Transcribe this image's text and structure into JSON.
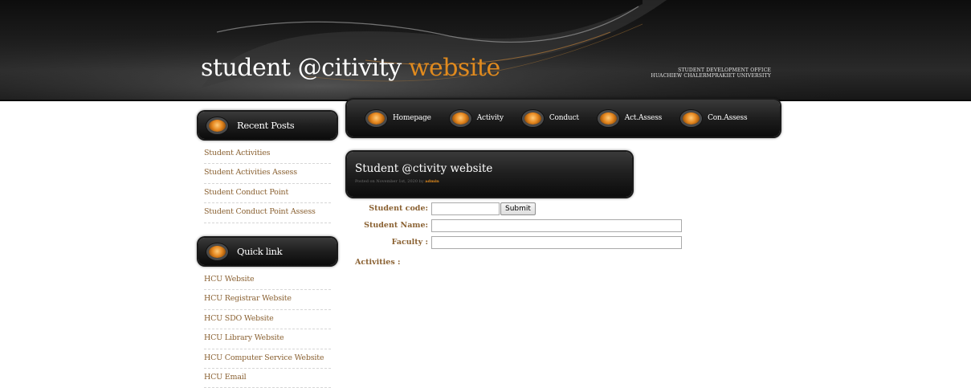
{
  "header": {
    "title_main": "student @citivity ",
    "title_accent": "website",
    "office_line1": "STUDENT DEVELOPMENT OFFICE",
    "office_line2": "HUACHIEW CHALERMPRAKIET UNIVERSITY"
  },
  "nav": {
    "items": [
      {
        "label": "Homepage"
      },
      {
        "label": "Activity"
      },
      {
        "label": "Conduct"
      },
      {
        "label": "Act.Assess"
      },
      {
        "label": "Con.Assess"
      }
    ]
  },
  "sidebar": {
    "recent": {
      "heading": "Recent Posts",
      "items": [
        {
          "label": "Student Activities"
        },
        {
          "label": "Student Activities Assess"
        },
        {
          "label": "Student Conduct Point"
        },
        {
          "label": "Student Conduct Point Assess"
        }
      ]
    },
    "quicklink": {
      "heading": "Quick link",
      "items": [
        {
          "label": "HCU Website"
        },
        {
          "label": "HCU Registrar Website"
        },
        {
          "label": "HCU SDO Website"
        },
        {
          "label": "HCU Library Website"
        },
        {
          "label": "HCU Computer Service Website"
        },
        {
          "label": "HCU Email"
        }
      ]
    }
  },
  "post": {
    "title": "Student @ctivity website",
    "meta_prefix": "Posted on November 1st, 2020 by ",
    "author": "admin"
  },
  "form": {
    "student_code_label": "Student code:",
    "student_code_value": "",
    "submit_label": "Submit",
    "student_name_label": "Student Name:",
    "student_name_value": "",
    "faculty_label": "Faculty :",
    "faculty_value": "",
    "activities_label": "Activities :"
  },
  "colors": {
    "accent": "#e08a1e",
    "link": "#8a6132",
    "header_bg": "#1b1b1b"
  }
}
